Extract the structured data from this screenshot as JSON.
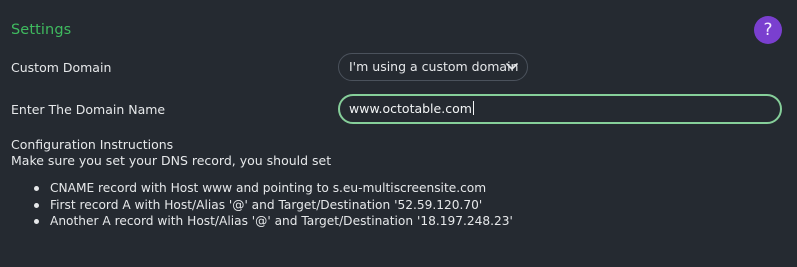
{
  "header": {
    "title": "Settings",
    "help_label": "?"
  },
  "custom_domain": {
    "label": "Custom Domain",
    "selected_option": "I'm using a custom domain",
    "chevron_icon": "chevron-down-icon"
  },
  "domain_name": {
    "label": "Enter The Domain Name",
    "value": "www.octotable.com"
  },
  "instructions": {
    "heading": "Configuration Instructions",
    "subheading": "Make sure you set your DNS record, you should set",
    "items": [
      "CNAME record with Host www and pointing to s.eu-multiscreensite.com",
      "First record A with Host/Alias '@' and Target/Destination '52.59.120.70'",
      "Another A record with Host/Alias '@' and Target/Destination '18.197.248.23'"
    ]
  },
  "colors": {
    "background": "#252a31",
    "accent_green": "#3fba5f",
    "input_focus_border": "#86cf9a",
    "help_purple": "#7a3fcf"
  }
}
